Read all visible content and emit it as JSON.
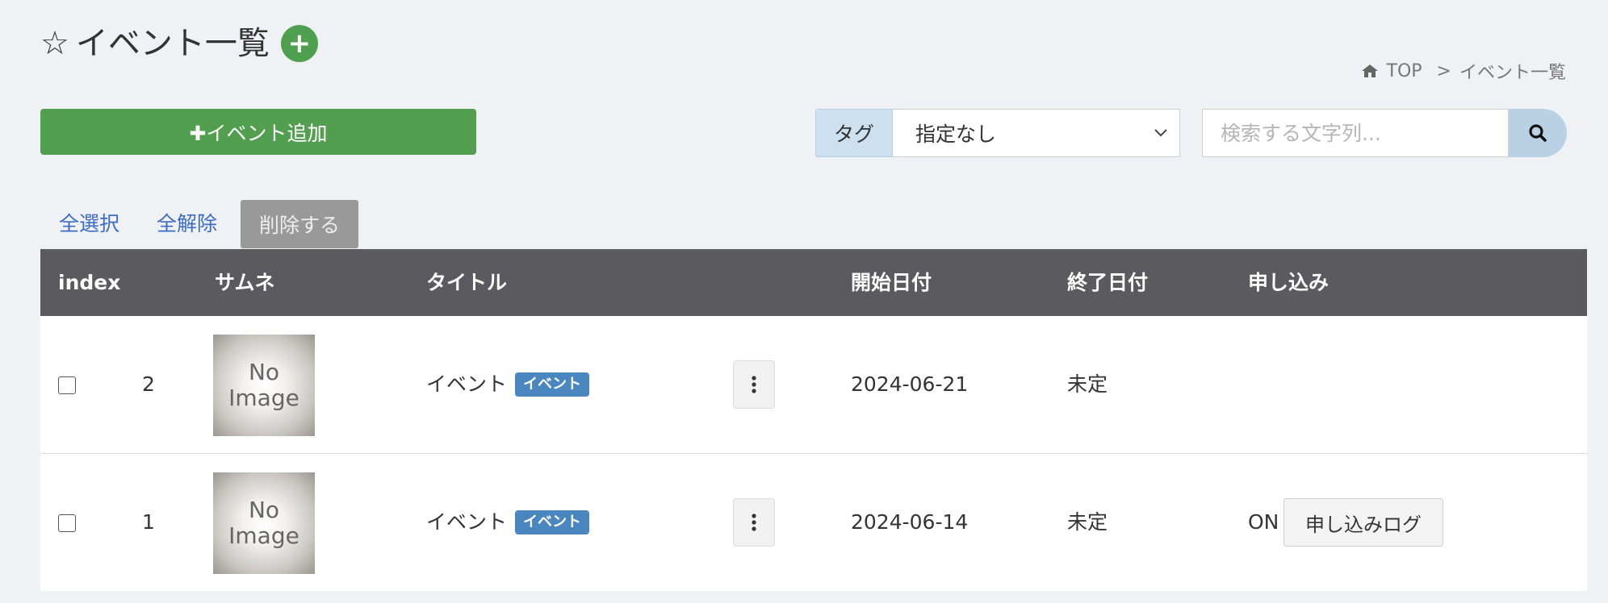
{
  "header": {
    "title": "イベント一覧",
    "add_symbol": "+"
  },
  "breadcrumb": {
    "home": "TOP",
    "separator": ">",
    "current": "イベント一覧"
  },
  "toolbar": {
    "add_event_label": "✚イベント追加",
    "tag_label": "タグ",
    "tag_selected": "指定なし",
    "search_placeholder": "検索する文字列..."
  },
  "actions": {
    "select_all": "全選択",
    "deselect_all": "全解除",
    "delete": "削除する"
  },
  "table": {
    "headers": {
      "index": "index",
      "thumbnail": "サムネ",
      "title": "タイトル",
      "start_date": "開始日付",
      "end_date": "終了日付",
      "application": "申し込み"
    },
    "rows": [
      {
        "index": "2",
        "thumb_line1": "No",
        "thumb_line2": "Image",
        "title": "イベント",
        "badge": "イベント",
        "start_date": "2024-06-21",
        "end_date": "未定",
        "application_status": "",
        "log_button": ""
      },
      {
        "index": "1",
        "thumb_line1": "No",
        "thumb_line2": "Image",
        "title": "イベント",
        "badge": "イベント",
        "start_date": "2024-06-14",
        "end_date": "未定",
        "application_status": "ON",
        "log_button": "申し込みログ"
      }
    ]
  },
  "colors": {
    "accent_green": "#52a04f",
    "badge_blue": "#4a86c0",
    "table_header": "#5a5a5f",
    "link_blue": "#3a6cc7"
  },
  "icons": [
    "star-icon",
    "plus-circle-icon",
    "home-icon",
    "chevron-down-icon",
    "search-icon",
    "kebab-menu-icon"
  ]
}
